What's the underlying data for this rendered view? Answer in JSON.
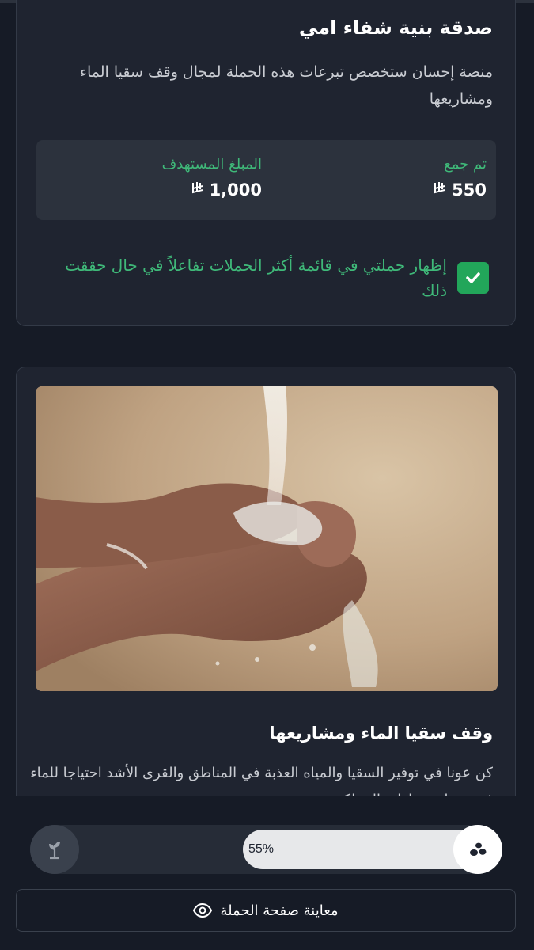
{
  "campaign": {
    "title": "صدقة بنية شفاء امي",
    "description": "منصة إحسان ستخصص تبرعات هذه الحملة لمجال وقف سقيا الماء ومشاريعها",
    "collected_label": "تم جمع",
    "collected_value": "550",
    "target_label": "المبلغ المستهدف",
    "target_value": "1,000",
    "currency_symbol": "⃁",
    "show_in_list_label": "إظهار حملتي في قائمة أكثر الحملات تفاعلاً في حال حققت ذلك",
    "show_in_list_checked": true
  },
  "project": {
    "image": "hands-water-icon",
    "title": "وقف سقيا الماء ومشاريعها",
    "description": "كن عونا في توفير السقيا والمياه العذبة في المناطق والقرى الأشد احتياجا للماء في مختلف مناطق المملكة"
  },
  "progress": {
    "value": 55,
    "label": "55%",
    "start_icon": "sprout-icon",
    "end_icon": "seeds-icon"
  },
  "actions": {
    "preview_label": "معاينة صفحة الحملة",
    "preview_icon": "eye-icon"
  },
  "colors": {
    "background": "#161b26",
    "card": "#1f2430",
    "accent_green": "#3fb979",
    "checkbox_green": "#22a65a"
  }
}
